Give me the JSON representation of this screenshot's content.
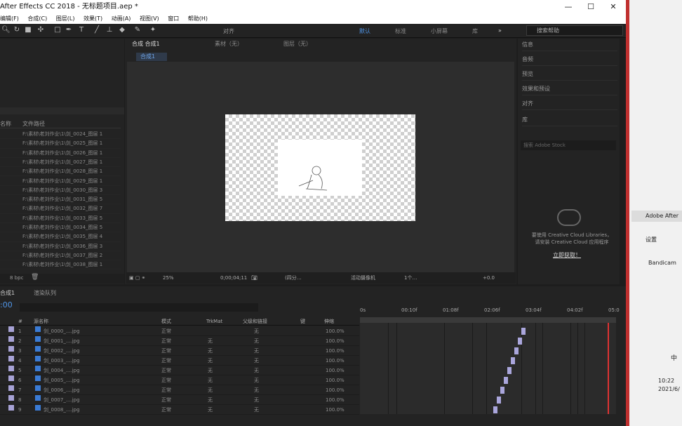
{
  "window": {
    "title": "After Effects CC 2018 - 无标题项目.aep *",
    "min": "—",
    "max": "☐",
    "close": "✕"
  },
  "menu": [
    "编辑(F)",
    "合成(C)",
    "图层(L)",
    "效果(T)",
    "动画(A)",
    "视图(V)",
    "窗口",
    "帮助(H)"
  ],
  "toolbar": {
    "align": "对齐",
    "workspaces": [
      "默认",
      "标准",
      "小屏幕",
      "库"
    ],
    "search_placeholder": "搜索帮助"
  },
  "project": {
    "col_name": "名称",
    "col_path": "文件路径",
    "rows": [
      "F:\\素材\\老刘作业\\1\\剑_0024_图层 1",
      "F:\\素材\\老刘作业\\1\\剑_0025_图层 1",
      "F:\\素材\\老刘作业\\1\\剑_0026_图层 1",
      "F:\\素材\\老刘作业\\1\\剑_0027_图层 1",
      "F:\\素材\\老刘作业\\1\\剑_0028_图层 1",
      "F:\\素材\\老刘作业\\1\\剑_0029_图层 1",
      "F:\\素材\\老刘作业\\1\\剑_0030_图层 3",
      "F:\\素材\\老刘作业\\1\\剑_0031_图层 5",
      "F:\\素材\\老刘作业\\1\\剑_0032_图层 7",
      "F:\\素材\\老刘作业\\1\\剑_0033_图层 5",
      "F:\\素材\\老刘作业\\1\\剑_0034_图层 5",
      "F:\\素材\\老刘作业\\1\\剑_0035_图层 4",
      "F:\\素材\\老刘作业\\1\\剑_0036_图层 3",
      "F:\\素材\\老刘作业\\1\\剑_0037_图层 2",
      "F:\\素材\\老刘作业\\1\\剑_0038_图层 1"
    ],
    "bpc": "8 bpc"
  },
  "comp": {
    "tab": "合成 合成1",
    "footage": "素材（无）",
    "layer": "图层（无）",
    "sub": "合成1",
    "zoom": "25%",
    "time": "0;00;04;11",
    "res": "(四分…",
    "camera": "活动摄像机",
    "views": "1个…",
    "exposure": "+0.0"
  },
  "panels": [
    "信息",
    "音频",
    "预览",
    "效果和预设",
    "对齐",
    "库"
  ],
  "library": {
    "search": "搜索 Adobe Stock",
    "msg1": "要使用 Creative Cloud Libraries，",
    "msg2": "请安装 Creative Cloud 应用程序",
    "link": "立即获取！"
  },
  "timeline": {
    "tab": "合成1",
    "render": "渲染队列",
    "timecode": ":00",
    "headers": {
      "num": "#",
      "name": "源名称",
      "mode": "模式",
      "trk": "TrkMat",
      "parent": "父级和链接",
      "key": "键",
      "stretch": "伸缩"
    },
    "ruler": [
      "0s",
      "00:10f",
      "01:08f",
      "02:06f",
      "03:04f",
      "04:02f",
      "05:0"
    ],
    "layers": [
      {
        "n": "1",
        "name": "剑_0000_....jpg",
        "mode": "正常",
        "trk": "",
        "parent": "无",
        "stretch": "100.0%"
      },
      {
        "n": "2",
        "name": "剑_0001_....jpg",
        "mode": "正常",
        "trk": "无",
        "parent": "无",
        "stretch": "100.0%"
      },
      {
        "n": "3",
        "name": "剑_0002_....jpg",
        "mode": "正常",
        "trk": "无",
        "parent": "无",
        "stretch": "100.0%"
      },
      {
        "n": "4",
        "name": "剑_0003_....jpg",
        "mode": "正常",
        "trk": "无",
        "parent": "无",
        "stretch": "100.0%"
      },
      {
        "n": "5",
        "name": "剑_0004_....jpg",
        "mode": "正常",
        "trk": "无",
        "parent": "无",
        "stretch": "100.0%"
      },
      {
        "n": "6",
        "name": "剑_0005_....jpg",
        "mode": "正常",
        "trk": "无",
        "parent": "无",
        "stretch": "100.0%"
      },
      {
        "n": "7",
        "name": "剑_0006_....jpg",
        "mode": "正常",
        "trk": "无",
        "parent": "无",
        "stretch": "100.0%"
      },
      {
        "n": "8",
        "name": "剑_0007_....jpg",
        "mode": "正常",
        "trk": "无",
        "parent": "无",
        "stretch": "100.0%"
      },
      {
        "n": "9",
        "name": "剑_0008_....jpg",
        "mode": "正常",
        "trk": "无",
        "parent": "无",
        "stretch": "100.0%"
      }
    ]
  },
  "desktop": {
    "ae": "Adobe After",
    "settings": "设置",
    "bandicam": "Bandicam",
    "ime": "中",
    "time": "10:22",
    "date": "2021/6/"
  }
}
